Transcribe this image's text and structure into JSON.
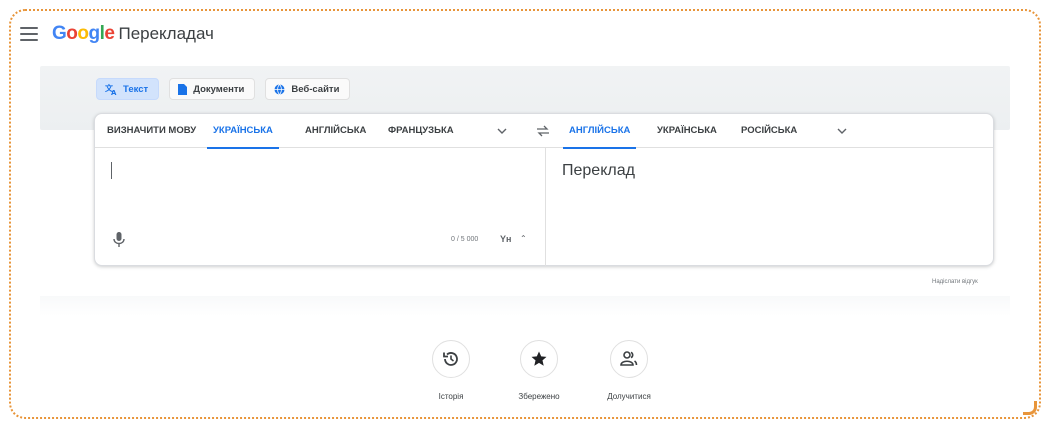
{
  "app": {
    "logo_letters": [
      {
        "ch": "G",
        "color": "#4285f4"
      },
      {
        "ch": "o",
        "color": "#ea4335"
      },
      {
        "ch": "o",
        "color": "#fbbc05"
      },
      {
        "ch": "g",
        "color": "#4285f4"
      },
      {
        "ch": "l",
        "color": "#34a853"
      },
      {
        "ch": "e",
        "color": "#ea4335"
      }
    ],
    "product_name": "Перекладач"
  },
  "modes": [
    {
      "label": "Текст",
      "icon": "translate-icon",
      "active": true
    },
    {
      "label": "Документи",
      "icon": "document-icon",
      "active": false
    },
    {
      "label": "Веб-сайти",
      "icon": "globe-icon",
      "active": false
    }
  ],
  "source_langs": [
    {
      "label": "ВИЗНАЧИТИ МОВУ",
      "active": false
    },
    {
      "label": "УКРАЇНСЬКА",
      "active": true
    },
    {
      "label": "АНГЛІЙСЬКА",
      "active": false
    },
    {
      "label": "ФРАНЦУЗЬКА",
      "active": false
    }
  ],
  "target_langs": [
    {
      "label": "АНГЛІЙСЬКА",
      "active": true
    },
    {
      "label": "УКРАЇНСЬКА",
      "active": false
    },
    {
      "label": "РОСІЙСЬКА",
      "active": false
    }
  ],
  "source": {
    "text": "",
    "char_count": "0 / 5 000",
    "keyboard_label": "Yн"
  },
  "target": {
    "placeholder": "Переклад"
  },
  "feedback_link": "Надіслати відгук",
  "shortcuts": [
    {
      "label": "Історія",
      "icon": "history-icon"
    },
    {
      "label": "Збережено",
      "icon": "star-icon"
    },
    {
      "label": "Долучитися",
      "icon": "community-icon"
    }
  ],
  "colors": {
    "accent": "#1a73e8",
    "frame_border": "#e8953a"
  }
}
